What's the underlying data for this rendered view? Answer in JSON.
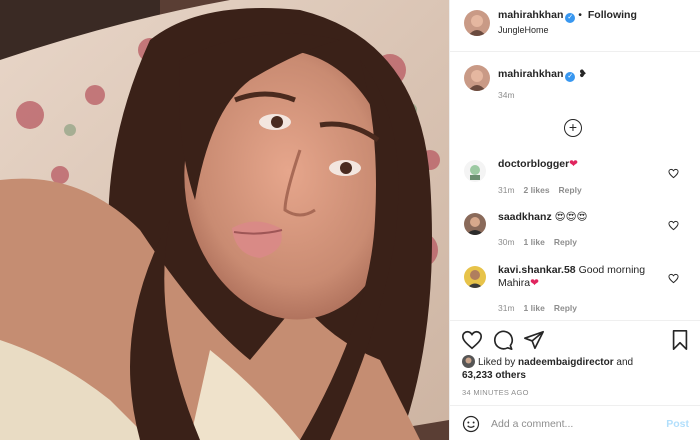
{
  "post": {
    "author": "mahirahkhan",
    "follow_sep": "•",
    "follow_label": "Following",
    "location": "JungleHome",
    "caption_emoji": "❥",
    "caption_time": "34m"
  },
  "comments": [
    {
      "user": "doctorblogger",
      "text": "❤",
      "time": "31m",
      "likes": "2 likes",
      "reply": "Reply"
    },
    {
      "user": "saadkhanz",
      "text": "😍😍😍",
      "time": "30m",
      "likes": "1 like",
      "reply": "Reply"
    },
    {
      "user": "kavi.shankar.58",
      "text": "Good morning Mahira",
      "text_emoji": "❤",
      "time": "31m",
      "likes": "1 like",
      "reply": "Reply"
    }
  ],
  "likes": {
    "prefix": "Liked by",
    "user": "nadeembaigdirector",
    "and": "and",
    "others": "63,233 others"
  },
  "posted_ago": "34 MINUTES AGO",
  "add_comment": {
    "placeholder": "Add a comment...",
    "post_label": "Post"
  },
  "icons": [
    "heart-icon",
    "comment-icon",
    "share-icon",
    "bookmark-icon",
    "emoji-icon",
    "add-circle-icon",
    "verified-badge-icon"
  ],
  "colors": {
    "verified": "#3897f0",
    "heart": "#e0245e",
    "post_disabled": "#b2dffc",
    "muted": "#8e8e8e"
  }
}
